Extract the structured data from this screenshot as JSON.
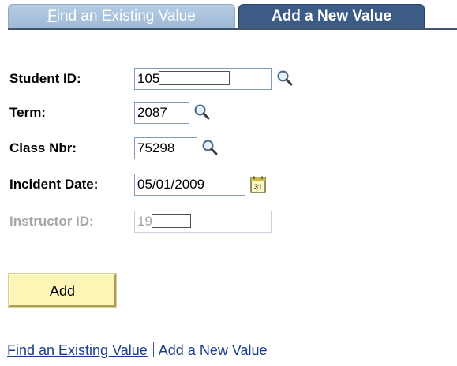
{
  "tabs": {
    "find_existing": {
      "accesskey_letter": "F",
      "rest": "ind an Existing Value"
    },
    "add_new": {
      "label": "Add a New Value"
    }
  },
  "form": {
    "student_id": {
      "label": "Student ID:",
      "value": "105",
      "icon": "magnifier-lookup-icon"
    },
    "term": {
      "label": "Term:",
      "value": "2087",
      "icon": "magnifier-lookup-icon"
    },
    "class_nbr": {
      "label": "Class Nbr:",
      "value": "75298",
      "icon": "magnifier-lookup-icon"
    },
    "incident_date": {
      "label": "Incident Date:",
      "value": "05/01/2009",
      "icon": "calendar-icon"
    },
    "instructor_id": {
      "label": "Instructor ID:",
      "value": "19",
      "disabled": true
    }
  },
  "buttons": {
    "add": "Add"
  },
  "footer": {
    "find_existing": "Find an Existing Value",
    "add_new": "Add a New Value"
  },
  "colors": {
    "active_tab": "#3c5c86",
    "inactive_tab": "#a9c2dd",
    "button_bg": "#fcf5b6",
    "link": "#1a3d8f",
    "disabled_text": "#a6a6a6"
  }
}
